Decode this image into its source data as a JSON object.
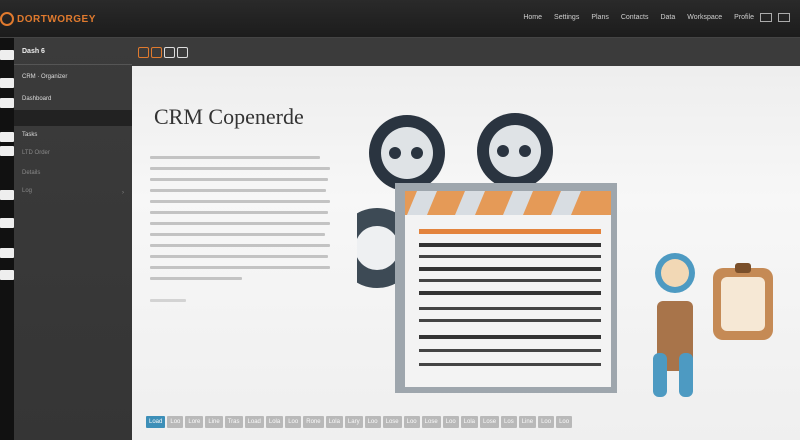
{
  "topbar": {
    "tagline": "",
    "brand": "DORTWORGEY",
    "nav": [
      "Home",
      "Settings",
      "Plans",
      "Contacts",
      "Data",
      "Workspace",
      "Profile"
    ]
  },
  "sidebar": {
    "icon_count": 9
  },
  "subsidebar": {
    "header": "Dash 6",
    "items": [
      {
        "label": "CRM · Organizer",
        "style": "normal"
      },
      {
        "label": "Dashboard",
        "style": "normal"
      },
      {
        "label": "",
        "style": "dark"
      },
      {
        "label": "Tasks",
        "style": "normal"
      },
      {
        "label": "LTD Order",
        "style": "muted"
      },
      {
        "label": "Details",
        "style": "muted"
      },
      {
        "label": "Log",
        "style": "muted"
      }
    ]
  },
  "toolbar": {
    "icons": [
      "doc-icon",
      "doc-icon",
      "doc-icon",
      "bd-icon"
    ]
  },
  "main": {
    "title": "CRM Copenerde",
    "paragraph_lines": 14
  },
  "tags": [
    "Load",
    "Loo",
    "Lore",
    "Line",
    "Tras",
    "Load",
    "Lola",
    "Loo",
    "Rone",
    "Lola",
    "Lary",
    "Loo",
    "Lose",
    "Loo",
    "Lose",
    "Loo",
    "Lola",
    "Lose",
    "Los",
    "Line",
    "Loo",
    "Loo"
  ],
  "colors": {
    "accent": "#e07a2e",
    "tag_active": "#3d8fb8"
  }
}
